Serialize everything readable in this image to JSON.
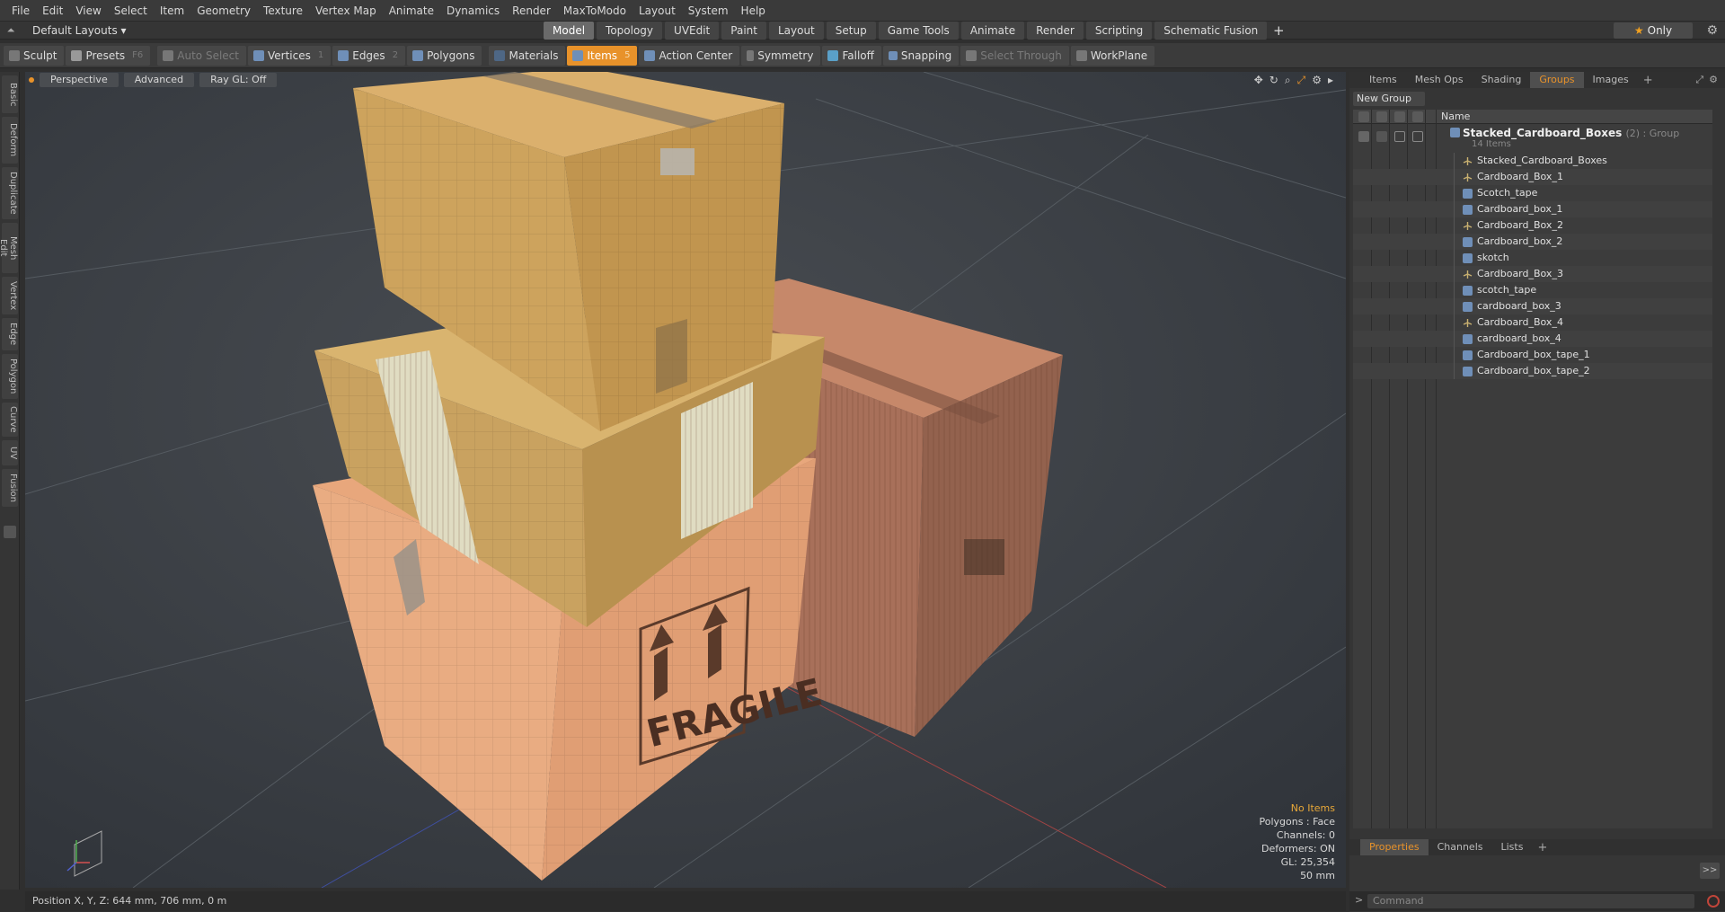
{
  "menu": [
    "File",
    "Edit",
    "View",
    "Select",
    "Item",
    "Geometry",
    "Texture",
    "Vertex Map",
    "Animate",
    "Dynamics",
    "Render",
    "MaxToModo",
    "Layout",
    "System",
    "Help"
  ],
  "layout_selector": "Default Layouts ▾",
  "tabs": [
    "Model",
    "Topology",
    "UVEdit",
    "Paint",
    "Layout",
    "Setup",
    "Game Tools",
    "Animate",
    "Render",
    "Scripting",
    "Schematic Fusion"
  ],
  "active_tab": "Model",
  "only_label": "Only",
  "toolbar": {
    "sculpt": "Sculpt",
    "presets": "Presets",
    "presets_key": "F6",
    "auto_select": "Auto Select",
    "vertices": "Vertices",
    "vertices_key": "1",
    "edges": "Edges",
    "edges_key": "2",
    "polygons": "Polygons",
    "materials": "Materials",
    "items": "Items",
    "items_key": "5",
    "action_center": "Action Center",
    "symmetry": "Symmetry",
    "falloff": "Falloff",
    "snapping": "Snapping",
    "select_through": "Select Through",
    "workplane": "WorkPlane"
  },
  "left_tabs": [
    "Basic",
    "Deform",
    "Duplicate",
    "Mesh Edit",
    "Vertex",
    "Edge",
    "Polygon",
    "Curve",
    "UV",
    "Fusion"
  ],
  "viewport": {
    "perspective": "Perspective",
    "advanced": "Advanced",
    "raygl": "Ray GL: Off",
    "fragile_text": "FRAGILE",
    "info": {
      "no_items": "No Items",
      "polygons": "Polygons : Face",
      "channels": "Channels: 0",
      "deformers": "Deformers: ON",
      "gl": "GL: 25,354",
      "scale": "50 mm"
    }
  },
  "right_panel": {
    "tabs": [
      "Items",
      "Mesh Ops",
      "Shading",
      "Groups",
      "Images"
    ],
    "active_tab": "Groups",
    "new_group": "New Group",
    "name_header": "Name",
    "group": {
      "name": "Stacked_Cardboard_Boxes",
      "meta": "(2) : Group",
      "sub": "14 Items"
    },
    "items": [
      {
        "name": "Stacked_Cardboard_Boxes",
        "type": "locator"
      },
      {
        "name": "Cardboard_Box_1",
        "type": "locator"
      },
      {
        "name": "Scotch_tape",
        "type": "mesh"
      },
      {
        "name": "Cardboard_box_1",
        "type": "mesh"
      },
      {
        "name": "Cardboard_Box_2",
        "type": "locator"
      },
      {
        "name": "Cardboard_box_2",
        "type": "mesh"
      },
      {
        "name": "skotch",
        "type": "mesh"
      },
      {
        "name": "Cardboard_Box_3",
        "type": "locator"
      },
      {
        "name": "scotch_tape",
        "type": "mesh"
      },
      {
        "name": "cardboard_box_3",
        "type": "mesh"
      },
      {
        "name": "Cardboard_Box_4",
        "type": "locator"
      },
      {
        "name": "cardboard_box_4",
        "type": "mesh"
      },
      {
        "name": "Cardboard_box_tape_1",
        "type": "mesh"
      },
      {
        "name": "Cardboard_box_tape_2",
        "type": "mesh"
      }
    ],
    "props_tabs": [
      "Properties",
      "Channels",
      "Lists"
    ],
    "props_active": "Properties",
    "expand": ">>"
  },
  "status": {
    "position": "Position X, Y, Z:   644 mm, 706 mm, 0 m"
  },
  "command": {
    "placeholder": "Command"
  },
  "colors": {
    "accent": "#e8922a",
    "mesh_icon": "#6f8fb8"
  }
}
